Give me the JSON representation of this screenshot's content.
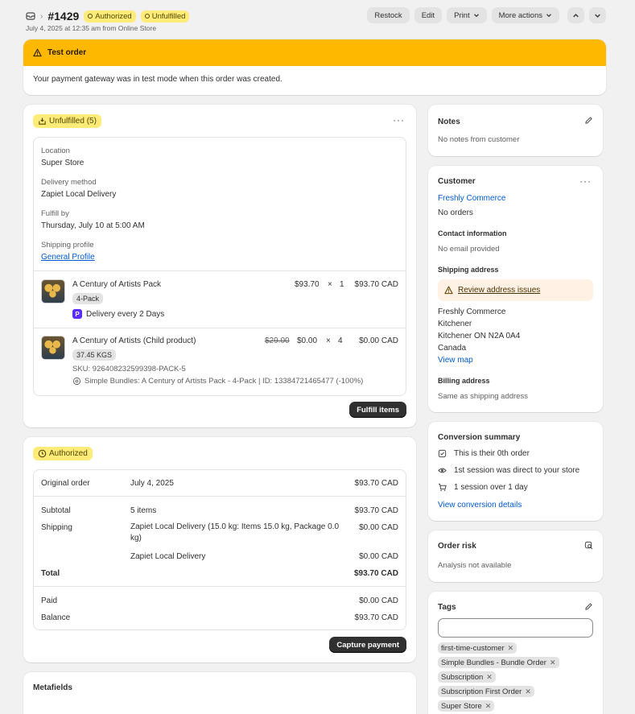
{
  "header": {
    "order_number": "#1429",
    "badges": [
      "Authorized",
      "Unfulfilled"
    ],
    "subtitle": "July 4, 2025 at 12:35 am from Online Store",
    "buttons": {
      "restock": "Restock",
      "edit": "Edit",
      "print": "Print",
      "more": "More actions"
    }
  },
  "banner": {
    "title": "Test order",
    "body": "Your payment gateway was in test mode when this order was created."
  },
  "fulfillment": {
    "status": "Unfulfilled (5)",
    "location_label": "Location",
    "location": "Super Store",
    "delivery_label": "Delivery method",
    "delivery": "Zapiet Local Delivery",
    "fulfill_by_label": "Fulfill by",
    "fulfill_by": "Thursday, July 10 at 5:00 AM",
    "shipping_profile_label": "Shipping profile",
    "shipping_profile": "General Profile",
    "items": [
      {
        "name": "A Century of Artists Pack",
        "variant": "4-Pack",
        "note": "Delivery every 2 Days",
        "price": "$93.70",
        "times": "×",
        "qty": "1",
        "total": "$93.70 CAD"
      },
      {
        "name": "A Century of Artists (Child product)",
        "variant": "37.45 KGS",
        "sku": "SKU: 926408232599398-PACK-5",
        "bundle": "Simple Bundles: A Century of Artists Pack - 4-Pack | ID: 13384721465477 (-100%)",
        "orig_price": "$29.00",
        "price": "$0.00",
        "times": "×",
        "qty": "4",
        "total": "$0.00 CAD"
      }
    ],
    "fulfill_button": "Fulfill items"
  },
  "payment": {
    "status": "Authorized",
    "original_label": "Original order",
    "original_date": "July 4, 2025",
    "original_amount": "$93.70 CAD",
    "subtotal_label": "Subtotal",
    "subtotal_desc": "5 items",
    "subtotal_amount": "$93.70 CAD",
    "shipping_label": "Shipping",
    "shipping_desc": "Zapiet Local Delivery (15.0 kg: Items 15.0 kg, Package 0.0 kg)",
    "shipping_amount": "$0.00 CAD",
    "shipping_desc2": "Zapiet Local Delivery",
    "shipping_amount2": "$0.00 CAD",
    "total_label": "Total",
    "total_amount": "$93.70 CAD",
    "paid_label": "Paid",
    "paid_amount": "$0.00 CAD",
    "balance_label": "Balance",
    "balance_amount": "$93.70 CAD",
    "capture_button": "Capture payment"
  },
  "metafields": {
    "title": "Metafields"
  },
  "notes": {
    "title": "Notes",
    "body": "No notes from customer"
  },
  "customer": {
    "title": "Customer",
    "name": "Freshly Commerce",
    "orders": "No orders",
    "contact_title": "Contact information",
    "contact": "No email provided",
    "shipping_title": "Shipping address",
    "review": "Review address issues",
    "address": [
      "Freshly Commerce",
      "Kitchener",
      "Kitchener ON N2A 0A4",
      "Canada"
    ],
    "view_map": "View map",
    "billing_title": "Billing address",
    "billing": "Same as shipping address"
  },
  "conversion": {
    "title": "Conversion summary",
    "items": [
      "This is their 0th order",
      "1st session was direct to your store",
      "1 session over 1 day"
    ],
    "link": "View conversion details"
  },
  "risk": {
    "title": "Order risk",
    "body": "Analysis not available"
  },
  "tags": {
    "title": "Tags",
    "input_value": "",
    "items": [
      "first-time-customer",
      "Simple Bundles - Bundle Order",
      "Subscription",
      "Subscription First Order",
      "Super Store"
    ]
  },
  "colors": {
    "accent": "#005bd3",
    "warning": "#ffb800",
    "badge": "#ffeb78",
    "dark": "#303030"
  }
}
